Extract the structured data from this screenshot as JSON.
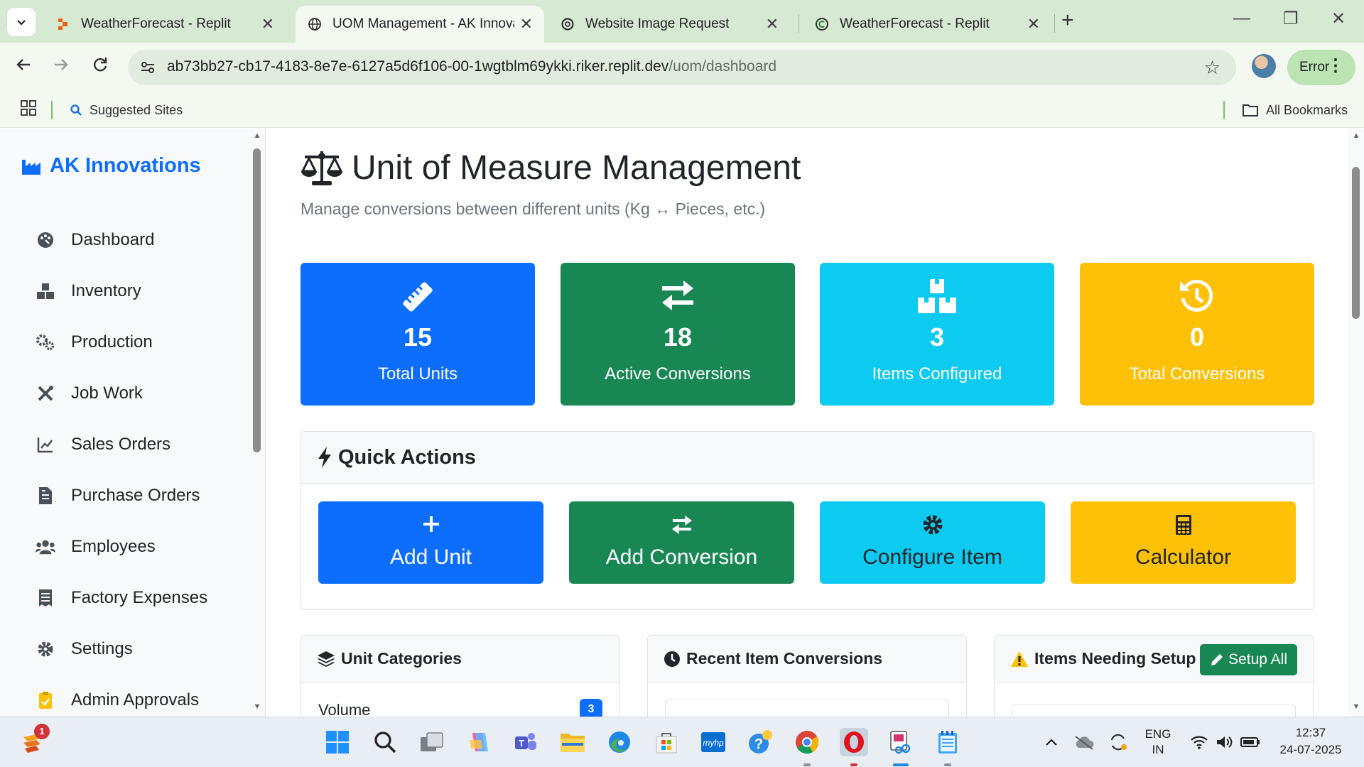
{
  "browser": {
    "tabs": [
      {
        "title": "WeatherForecast - Replit",
        "active": false,
        "favicon": "replit-icon"
      },
      {
        "title": "UOM Management - AK Innova",
        "active": true,
        "favicon": "globe-icon"
      },
      {
        "title": "Website Image Request",
        "active": false,
        "favicon": "chatgpt-icon"
      },
      {
        "title": "WeatherForecast - Replit",
        "active": false,
        "favicon": "replit-icon"
      }
    ],
    "new_tab": "+",
    "url_host": "ab73bb27-cb17-4183-8e7e-6127a5d6f106-00-1wgtblm69ykki.riker.replit.dev",
    "url_path": "/uom/dashboard",
    "error_label": "Error",
    "bookmarks": {
      "suggested": "Suggested Sites",
      "all": "All Bookmarks"
    }
  },
  "sidebar": {
    "brand": "AK Innovations",
    "items": [
      {
        "label": "Dashboard",
        "icon": "palette-icon"
      },
      {
        "label": "Inventory",
        "icon": "boxes-icon"
      },
      {
        "label": "Production",
        "icon": "cogs-icon"
      },
      {
        "label": "Job Work",
        "icon": "tools-icon"
      },
      {
        "label": "Sales Orders",
        "icon": "chart-line-icon"
      },
      {
        "label": "Purchase Orders",
        "icon": "file-invoice-icon"
      },
      {
        "label": "Employees",
        "icon": "users-icon"
      },
      {
        "label": "Factory Expenses",
        "icon": "receipt-icon"
      },
      {
        "label": "Settings",
        "icon": "gear-icon"
      },
      {
        "label": "Admin Approvals",
        "icon": "clipboard-check-icon"
      }
    ]
  },
  "main": {
    "title": "Unit of Measure Management",
    "subtitle": "Manage conversions between different units (Kg ↔ Pieces, etc.)",
    "stats": [
      {
        "value": "15",
        "label": "Total Units",
        "icon": "ruler-icon",
        "color": "#0d6efd"
      },
      {
        "value": "18",
        "label": "Active Conversions",
        "icon": "exchange-icon",
        "color": "#198754"
      },
      {
        "value": "3",
        "label": "Items Configured",
        "icon": "boxes-icon",
        "color": "#0dcaf0"
      },
      {
        "value": "0",
        "label": "Total Conversions",
        "icon": "history-icon",
        "color": "#ffc107"
      }
    ],
    "quick_actions": {
      "title": "Quick Actions",
      "buttons": [
        {
          "label": "Add Unit",
          "icon": "plus-icon",
          "color": "#0d6efd"
        },
        {
          "label": "Add Conversion",
          "icon": "exchange-icon",
          "color": "#198754"
        },
        {
          "label": "Configure Item",
          "icon": "gear-icon",
          "color": "#0dcaf0"
        },
        {
          "label": "Calculator",
          "icon": "calculator-icon",
          "color": "#ffc107"
        }
      ]
    },
    "panels": {
      "categories": {
        "title": "Unit Categories",
        "first_row": "Volume",
        "first_count": "3"
      },
      "recent": {
        "title": "Recent Item Conversions"
      },
      "setup": {
        "title": "Items Needing Setup",
        "button": "Setup All"
      }
    }
  },
  "taskbar": {
    "notification_count": "1",
    "language": "ENG",
    "region": "IN",
    "time": "12:37",
    "date": "24-07-2025"
  }
}
